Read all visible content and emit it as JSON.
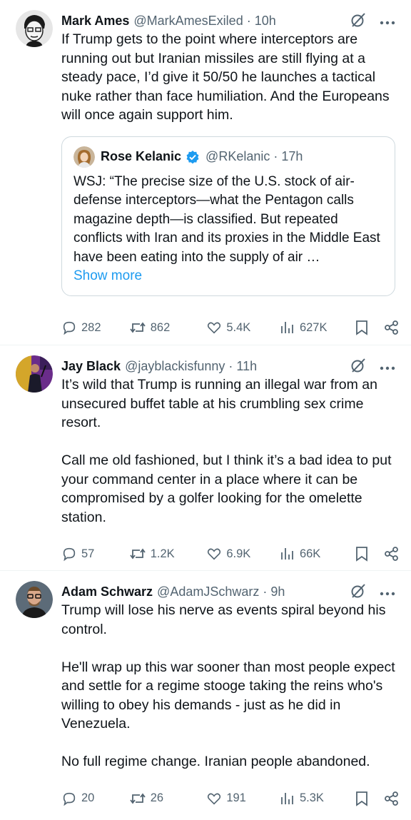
{
  "tweets": [
    {
      "name": "Mark Ames",
      "handle": "@MarkAmesExiled · 10h",
      "text": "If Trump gets to the point where interceptors are running out but Iranian missiles are still flying at a steady pace, I’d give it 50/50 he launches a tactical nuke rather than face humiliation. And the Europeans will once again support him.",
      "quote": {
        "name": "Rose Kelanic",
        "handle": "@RKelanic · 17h",
        "text": "WSJ: “The precise size of the U.S. stock of air-defense interceptors—what the Pentagon calls magazine depth—is classified. But repeated conflicts with Iran and its proxies in the Middle East have been eating into the supply of air …",
        "show_more": "Show more"
      },
      "replies": "282",
      "reposts": "862",
      "likes": "5.4K",
      "views": "627K"
    },
    {
      "name": "Jay Black",
      "handle": "@jayblackisfunny · 11h",
      "text": "It’s wild that Trump is running an illegal war from an unsecured buffet table at his crumbling sex crime resort.\n\nCall me old fashioned, but I think it’s a bad idea to put your command center in a place where it can be compromised by a golfer looking for the omelette station.",
      "replies": "57",
      "reposts": "1.2K",
      "likes": "6.9K",
      "views": "66K"
    },
    {
      "name": "Adam Schwarz",
      "handle": "@AdamJSchwarz · 9h",
      "text": "Trump will lose his nerve as events spiral beyond his control.\n\nHe'll wrap up this war sooner than most people expect and settle for a regime stooge taking the reins who's willing to obey his demands - just as he did in Venezuela.\n\nNo full regime change. Iranian people abandoned.",
      "replies": "20",
      "reposts": "26",
      "likes": "191",
      "views": "5.3K"
    }
  ],
  "colors": {
    "accent": "#1d9bf0",
    "secondary_text": "#536471",
    "border": "#cfd9de"
  },
  "icons": [
    "grok-icon",
    "more-icon",
    "reply-icon",
    "repost-icon",
    "like-icon",
    "views-icon",
    "bookmark-icon",
    "share-icon",
    "verified-badge-icon"
  ]
}
